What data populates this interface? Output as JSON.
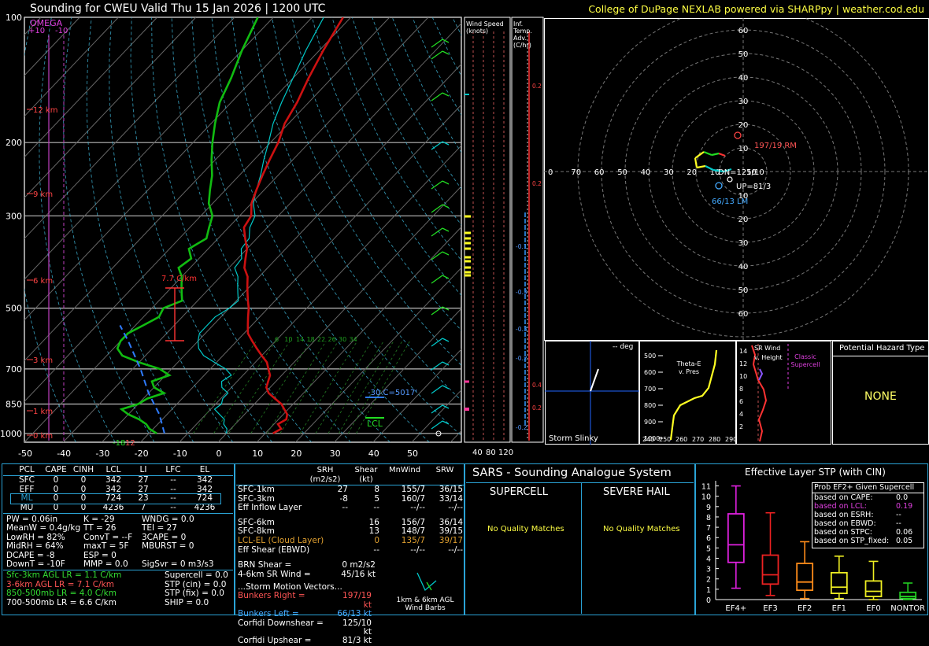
{
  "header": {
    "title": "Sounding for CWEU Valid  Thu 15 Jan 2026 | 1200 UTC",
    "credit": "College of DuPage NEXLAB powered via SHARPpy | weather.cod.edu"
  },
  "skewt": {
    "omega_label": "OMEGA",
    "omega_ticks": [
      "+10",
      "-10"
    ],
    "pressure_labels": [
      "100",
      "200",
      "300",
      "500",
      "700",
      "850",
      "1000"
    ],
    "temp_labels": [
      "-50",
      "-40",
      "-30",
      "-20",
      "-10",
      "0",
      "10",
      "20",
      "30",
      "40",
      "50"
    ],
    "height_labels": [
      "12 km",
      "9 km",
      "6 km",
      "3 km",
      "1 km",
      "0 km"
    ],
    "lapse_rate_label": "7.7 C/km",
    "mixing_ratio_labels": [
      "6",
      "10",
      "14",
      "18",
      "22",
      "26",
      "30",
      "34"
    ],
    "wetbulb_label": "-30 C=5017'",
    "lcl_label": "LCL",
    "sfc_temp_label": "12",
    "sfc_dew_label": "-18",
    "inset_cursor_label": "—",
    "colors": {
      "temp": "#cc1111",
      "dew": "#11bb11",
      "wetbulb": "#00c8c8",
      "parcel": "#ff6666",
      "omega": "#c040c0"
    }
  },
  "wind_speed_panel": {
    "title": "Wind Speed (knots)",
    "ticks": [
      "40",
      "80",
      "120"
    ]
  },
  "temp_adv_panel": {
    "title": "Inf. Temp. Adv. (C/hr)",
    "values": [
      "0.2",
      "0.2",
      "-0.1",
      "-0.3",
      "-0.3",
      "-0.2",
      "0.4",
      "0.2",
      "-0.2"
    ]
  },
  "hodograph": {
    "ring_labels": [
      "10",
      "20",
      "30",
      "40",
      "50",
      "60"
    ],
    "axis_labels": [
      "0",
      "70",
      "60",
      "50",
      "40",
      "30",
      "20",
      "10"
    ],
    "right_mover": "197/19 RM",
    "left_mover": "66/13 LM",
    "downshear": "DN=125/10",
    "upshear": "UP=81/3"
  },
  "inset_slinky": {
    "title": "Storm Slinky",
    "deg": "-- deg"
  },
  "inset_thetae": {
    "title": "Theta-E v. Pres",
    "pres_labels": [
      "500",
      "600",
      "700",
      "800",
      "900",
      "1000"
    ],
    "temp_labels": [
      "240",
      "250",
      "260",
      "270",
      "280",
      "290"
    ]
  },
  "inset_srwind": {
    "title": "SR Wind v. Height",
    "heights": [
      "14",
      "12",
      "10",
      "8",
      "6",
      "4",
      "2"
    ],
    "label": "Classic Supercell"
  },
  "hazard": {
    "title": "Potential Hazard Type",
    "value": "NONE"
  },
  "parcel_table": {
    "headers": [
      "PCL",
      "CAPE",
      "CINH",
      "LCL",
      "LI",
      "LFC",
      "EL"
    ],
    "rows": [
      [
        "SFC",
        "0",
        "0",
        "342",
        "27",
        "--",
        "342"
      ],
      [
        "EFF",
        "0",
        "0",
        "342",
        "27",
        "--",
        "342"
      ],
      [
        "ML",
        "0",
        "0",
        "724",
        "23",
        "--",
        "724"
      ],
      [
        "MU",
        "0",
        "0",
        "4236",
        "7",
        "--",
        "4236"
      ]
    ]
  },
  "thermo_indices": [
    [
      "PW = 0.06in",
      "K = -29",
      "WNDG = 0.0"
    ],
    [
      "MeanW = 0.4g/kg",
      "TT = 26",
      "TEI = 27"
    ],
    [
      "LowRH = 82%",
      "ConvT = --F",
      "3CAPE = 0"
    ],
    [
      "MidRH = 64%",
      "maxT = 5F",
      "MBURST = 0"
    ],
    [
      "DCAPE = -8",
      "ESP = 0",
      ""
    ],
    [
      "DownT = -10F",
      "MMP = 0.0",
      "SigSvr = 0 m3/s3"
    ]
  ],
  "lapse_rates": [
    {
      "label": "Sfc-3km AGL LR = 1.1 C/km",
      "color": "#33dd33"
    },
    {
      "label": "3-6km AGL LR = 7.1 C/km",
      "color": "#ff5555"
    },
    {
      "label": "850-500mb LR = 4.0 C/km",
      "color": "#33dd33"
    },
    {
      "label": "700-500mb LR = 6.6 C/km",
      "color": "#ffffff"
    }
  ],
  "composites": [
    "Supercell = 0.0",
    "STP (cin) = 0.0",
    "STP (fix) = 0.0",
    "SHIP = 0.0"
  ],
  "kinematics": {
    "headers": [
      "SRH (m2/s2)",
      "Shear (kt)",
      "MnWind",
      "SRW"
    ],
    "rows": [
      {
        "label": "SFC-1km",
        "v": [
          "27",
          "8",
          "155/7",
          "36/15"
        ],
        "color": "#ffffff"
      },
      {
        "label": "SFC-3km",
        "v": [
          "-8",
          "5",
          "160/7",
          "33/14"
        ],
        "color": "#ffffff"
      },
      {
        "label": "Eff Inflow Layer",
        "v": [
          "--",
          "--",
          "--/--",
          "--/--"
        ],
        "color": "#ffffff"
      },
      {
        "label": "SFC-6km",
        "v": [
          "16",
          "156/7",
          "36/14"
        ],
        "color": "#ffffff"
      },
      {
        "label": "SFC-8km",
        "v": [
          "13",
          "148/7",
          "39/15"
        ],
        "color": "#ffffff"
      },
      {
        "label": "LCL-EL (Cloud Layer)",
        "v": [
          "0",
          "135/7",
          "39/17"
        ],
        "color": "#e0a030"
      },
      {
        "label": "Eff Shear (EBWD)",
        "v": [
          "--",
          "--/--",
          "--/--"
        ],
        "color": "#ffffff"
      }
    ],
    "brn_shear": "BRN Shear =",
    "brn_value": "0 m2/s2",
    "srw46": "4-6km SR Wind =",
    "srw46_value": "45/16 kt",
    "storm_motion_title": "...Storm Motion Vectors...",
    "motions": [
      {
        "label": "Bunkers Right =",
        "value": "197/19 kt",
        "color": "#ff5555"
      },
      {
        "label": "Bunkers Left =",
        "value": "66/13 kt",
        "color": "#44aaff"
      },
      {
        "label": "Corfidi Downshear =",
        "value": "125/10 kt",
        "color": "#ffffff"
      },
      {
        "label": "Corfidi Upshear =",
        "value": "81/3 kt",
        "color": "#ffffff"
      }
    ],
    "barb_caption": "1km & 6km AGL Wind Barbs"
  },
  "sars": {
    "title": "SARS - Sounding Analogue System",
    "supercell": "SUPERCELL",
    "hail": "SEVERE HAIL",
    "supercell_msg": "No Quality Matches",
    "hail_msg": "No Quality Matches"
  },
  "stp": {
    "title": "Effective Layer STP (with CIN)",
    "y_labels": [
      "11",
      "10",
      "9",
      "8",
      "7",
      "6",
      "5",
      "4",
      "3",
      "2",
      "1",
      "0"
    ],
    "categories": [
      "EF4+",
      "EF3",
      "EF2",
      "EF1",
      "EF0",
      "NONTOR"
    ],
    "prob_title": "Prob EF2+ Given Supercell",
    "prob_rows": [
      {
        "label": "based on CAPE:",
        "value": "0.0",
        "color": "#ffffff"
      },
      {
        "label": "based on LCL:",
        "value": "0.19",
        "color": "#e040e0"
      },
      {
        "label": "based on ESRH:",
        "value": "--",
        "color": "#ffffff"
      },
      {
        "label": "based on EBWD:",
        "value": "--",
        "color": "#ffffff"
      },
      {
        "label": "based on STPC:",
        "value": "0.06",
        "color": "#ffffff"
      },
      {
        "label": "based on STP_fixed:",
        "value": "0.05",
        "color": "#ffffff"
      }
    ]
  },
  "chart_data": {
    "type": "box",
    "title": "Effective Layer STP (with CIN)",
    "categories": [
      "EF4+",
      "EF3",
      "EF2",
      "EF1",
      "EF0",
      "NONTOR"
    ],
    "boxes": [
      {
        "name": "EF4+",
        "low": 1.1,
        "q1": 3.6,
        "median": 5.3,
        "q3": 8.3,
        "high": 11.0,
        "color": "#e020e0"
      },
      {
        "name": "EF3",
        "low": 0.4,
        "q1": 1.5,
        "median": 2.4,
        "q3": 4.3,
        "high": 8.4,
        "color": "#ee2222"
      },
      {
        "name": "EF2",
        "low": 0.1,
        "q1": 0.9,
        "median": 1.7,
        "q3": 3.5,
        "high": 5.6,
        "color": "#ff8c1a"
      },
      {
        "name": "EF1",
        "low": 0.1,
        "q1": 0.6,
        "median": 1.2,
        "q3": 2.6,
        "high": 4.2,
        "color": "#eeee22"
      },
      {
        "name": "EF0",
        "low": 0.0,
        "q1": 0.3,
        "median": 0.8,
        "q3": 1.8,
        "high": 3.7,
        "color": "#eeee22"
      },
      {
        "name": "NONTOR",
        "low": 0.0,
        "q1": 0.1,
        "median": 0.3,
        "q3": 0.7,
        "high": 1.6,
        "color": "#22cc22"
      }
    ],
    "ylim": [
      0,
      11.5
    ]
  }
}
